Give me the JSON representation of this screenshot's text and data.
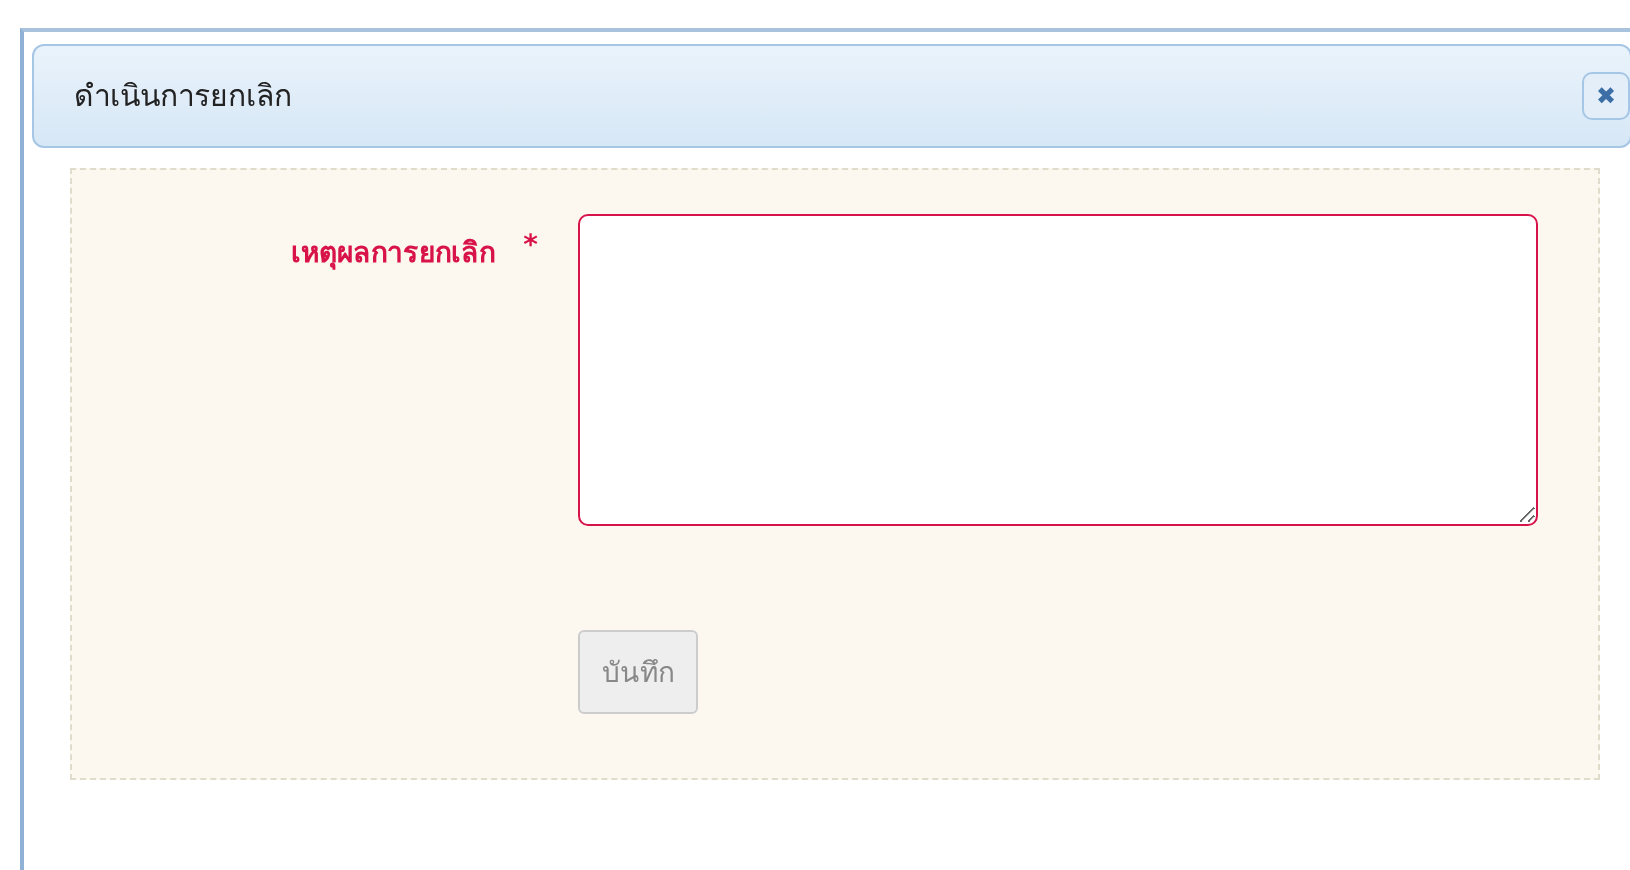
{
  "dialog": {
    "title": "ดำเนินการยกเลิก",
    "close_icon": "✖"
  },
  "form": {
    "field": {
      "label": "เหตุผลการยกเลิก",
      "required_mark": "*",
      "invalid": true
    },
    "save_button": {
      "label": "บันทึก",
      "disabled": true
    }
  }
}
